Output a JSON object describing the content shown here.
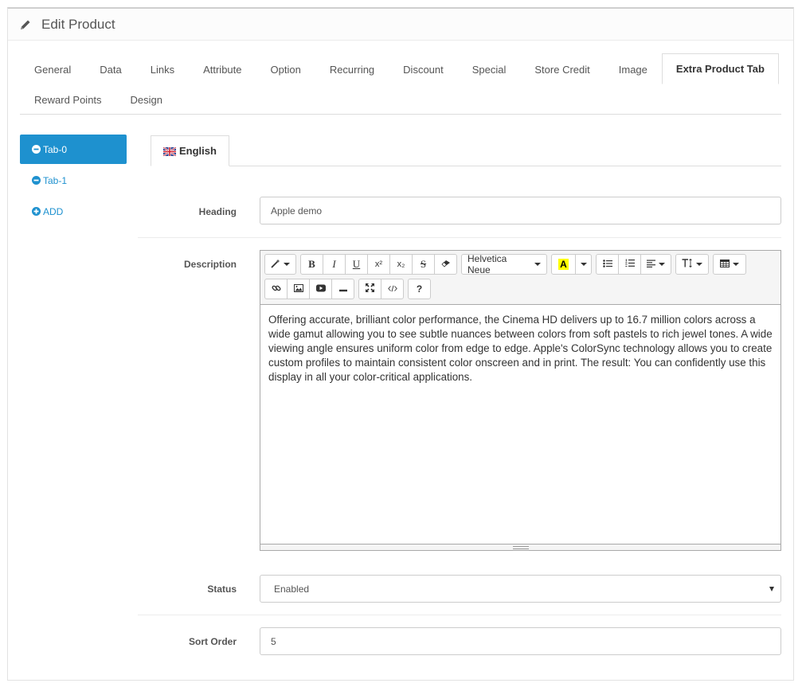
{
  "header": {
    "title": "Edit Product",
    "icon": "pencil-icon"
  },
  "tabs": [
    {
      "label": "General"
    },
    {
      "label": "Data"
    },
    {
      "label": "Links"
    },
    {
      "label": "Attribute"
    },
    {
      "label": "Option"
    },
    {
      "label": "Recurring"
    },
    {
      "label": "Discount"
    },
    {
      "label": "Special"
    },
    {
      "label": "Store Credit"
    },
    {
      "label": "Image"
    },
    {
      "label": "Extra Product Tab",
      "active": true
    },
    {
      "label": "Reward Points"
    },
    {
      "label": "Design"
    }
  ],
  "pills": [
    {
      "label": "Tab-0",
      "icon": "minus-circle-icon",
      "active": true
    },
    {
      "label": "Tab-1",
      "icon": "minus-circle-icon"
    },
    {
      "label": "ADD",
      "icon": "plus-circle-icon"
    }
  ],
  "language_tab": {
    "label": "English",
    "icon": "uk-flag-icon"
  },
  "form": {
    "heading_label": "Heading",
    "heading_value": "Apple demo",
    "description_label": "Description",
    "description_text": "Offering accurate, brilliant color performance, the Cinema HD delivers up to 16.7 million colors across a wide gamut allowing you to see subtle nuances between colors from soft pastels to rich jewel tones. A wide viewing angle ensures uniform color from edge to edge. Apple's ColorSync technology allows you to create custom profiles to maintain consistent color onscreen and in print. The result: You can confidently use this display in all your color-critical applications.",
    "status_label": "Status",
    "status_value": "Enabled",
    "sort_order_label": "Sort Order",
    "sort_order_value": "5"
  },
  "editor": {
    "font_name": "Helvetica Neue",
    "bold": "B",
    "italic": "I",
    "underline": "U",
    "superscript": "x²",
    "subscript": "x₂",
    "strike": "S",
    "color_letter": "A",
    "help": "?",
    "highlight_color": "#ffff00"
  },
  "colors": {
    "accent": "#1e91cf"
  }
}
